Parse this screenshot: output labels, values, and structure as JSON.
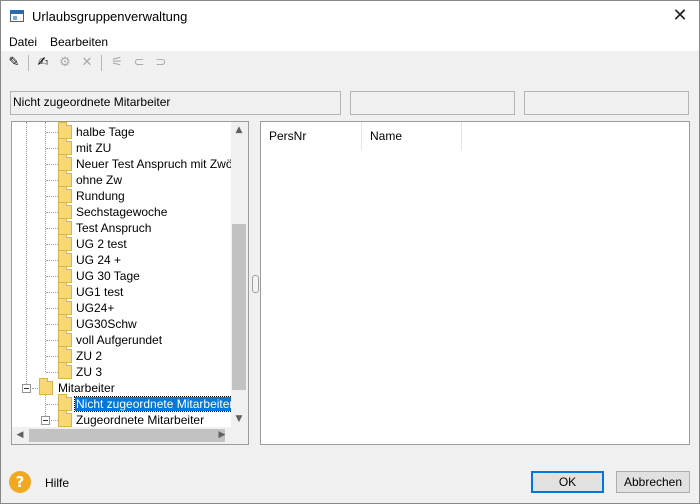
{
  "window": {
    "title": "Urlaubsgruppenverwaltung",
    "close_glyph": "✕"
  },
  "menu": {
    "items": [
      "Datei",
      "Bearbeiten"
    ]
  },
  "toolbar": {
    "icons": [
      {
        "name": "tool-wand-icon",
        "glyph": "✎",
        "enabled": true
      },
      {
        "name": "edit-user-icon",
        "glyph": "✍",
        "enabled": true
      },
      {
        "name": "properties-icon",
        "glyph": "⚙",
        "enabled": false
      },
      {
        "name": "delete-icon",
        "glyph": "✕",
        "enabled": false
      },
      {
        "name": "assign-icon",
        "glyph": "⚟",
        "enabled": false
      },
      {
        "name": "link-icon",
        "glyph": "⊂",
        "enabled": false
      },
      {
        "name": "unlink-icon",
        "glyph": "⊃",
        "enabled": false
      }
    ]
  },
  "status": {
    "primary": "Nicht zugeordnete Mitarbeiter",
    "secondary": "",
    "tertiary": ""
  },
  "tree": {
    "groups": [
      "halbe Tage",
      "mit ZU",
      "Neuer Test Anspruch mit Zwölftel",
      "ohne Zw",
      "Rundung",
      "Sechstagewoche",
      "Test Anspruch",
      "UG 2 test",
      "UG 24 +",
      "UG 30 Tage",
      "UG1 test",
      "UG24+",
      "UG30Schw",
      "voll Aufgerundet",
      "ZU 2",
      "ZU 3"
    ],
    "employees_node": "Mitarbeiter",
    "unassigned_node": "Nicht zugeordnete Mitarbeiter",
    "assigned_node": "Zugeordnete Mitarbeiter",
    "scroll_up_glyph": "▲",
    "scroll_down_glyph": "▼",
    "scroll_left_glyph": "◀",
    "scroll_right_glyph": "▶"
  },
  "list": {
    "columns": [
      "PersNr",
      "Name"
    ]
  },
  "footer": {
    "help_glyph": "?",
    "help_label": "Hilfe",
    "ok_label": "OK",
    "cancel_label": "Abbrechen"
  },
  "colors": {
    "selection": "#0078d7",
    "folder": "#f8d775",
    "help": "#f1a81f"
  }
}
